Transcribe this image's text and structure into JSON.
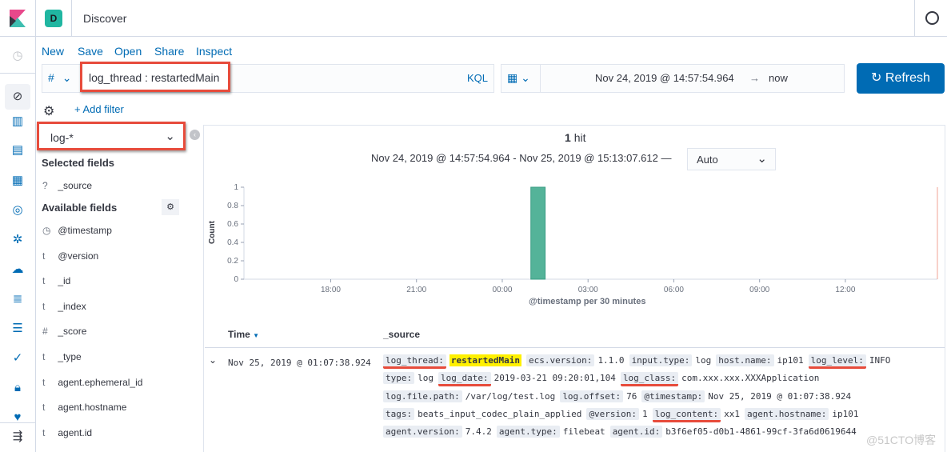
{
  "header": {
    "space_badge": "D",
    "title": "Discover",
    "logo": "kibana-logo",
    "help_icon": "help-icon"
  },
  "menu": {
    "new": "New",
    "save": "Save",
    "open": "Open",
    "share": "Share",
    "inspect": "Inspect"
  },
  "query": {
    "type_symbol": "#",
    "value": "log_thread : restartedMain",
    "language": "KQL"
  },
  "time": {
    "start": "Nov 24, 2019 @ 14:57:54.964",
    "arrow": "→",
    "end": "now",
    "refresh": "Refresh"
  },
  "filters": {
    "add_filter": "+ Add filter"
  },
  "index_pattern": "log-*",
  "sidebar": {
    "selected_title": "Selected fields",
    "selected": [
      {
        "type": "?",
        "name": "_source"
      }
    ],
    "available_title": "Available fields",
    "available": [
      {
        "type": "clock",
        "name": "@timestamp"
      },
      {
        "type": "t",
        "name": "@version"
      },
      {
        "type": "t",
        "name": "_id"
      },
      {
        "type": "t",
        "name": "_index"
      },
      {
        "type": "#",
        "name": "_score"
      },
      {
        "type": "t",
        "name": "_type"
      },
      {
        "type": "t",
        "name": "agent.ephemeral_id"
      },
      {
        "type": "t",
        "name": "agent.hostname"
      },
      {
        "type": "t",
        "name": "agent.id"
      }
    ]
  },
  "results": {
    "hits": "1",
    "hits_label": "hit",
    "range": "Nov 24, 2019 @ 14:57:54.964 - Nov 25, 2019 @ 15:13:07.612 —",
    "interval": "Auto"
  },
  "chart_data": {
    "type": "bar",
    "xlabel": "@timestamp per 30 minutes",
    "ylabel": "Count",
    "x_ticks": [
      "18:00",
      "21:00",
      "00:00",
      "03:00",
      "06:00",
      "09:00",
      "12:00"
    ],
    "y_ticks": [
      "0",
      "0.2",
      "0.4",
      "0.6",
      "0.8",
      "1"
    ],
    "ylim": [
      0,
      1
    ],
    "xlim": [
      "Nov 24, 2019 14:57:54.964",
      "Nov 25, 2019 15:13:07.612"
    ],
    "bars": [
      {
        "x": "Nov 25, 2019 01:00",
        "value": 1
      }
    ],
    "bar_color": "#54b399"
  },
  "table": {
    "col_time": "Time",
    "col_source": "_source",
    "row": {
      "time": "Nov 25, 2019 @ 01:07:38.924",
      "lines": [
        [
          [
            "log_thread:",
            "restartedMain",
            true,
            true
          ],
          [
            "ecs.version:",
            "1.1.0"
          ],
          [
            "input.type:",
            "log"
          ],
          [
            "host.name:",
            "ip101"
          ],
          [
            "log_level:",
            "INFO",
            true
          ]
        ],
        [
          [
            "type:",
            "log"
          ],
          [
            "log_date:",
            "2019-03-21 09:20:01,104",
            true
          ],
          [
            "log_class:",
            "com.xxx.xxx.XXXApplication",
            true
          ]
        ],
        [
          [
            "log.file.path:",
            "/var/log/test.log"
          ],
          [
            "log.offset:",
            "76"
          ],
          [
            "@timestamp:",
            "Nov 25, 2019 @ 01:07:38.924"
          ]
        ],
        [
          [
            "tags:",
            "beats_input_codec_plain_applied"
          ],
          [
            "@version:",
            "1"
          ],
          [
            "log_content:",
            "xx1",
            true
          ],
          [
            "agent.hostname:",
            "ip101"
          ]
        ],
        [
          [
            "agent.version:",
            "7.4.2"
          ],
          [
            "agent.type:",
            "filebeat"
          ],
          [
            "agent.id:",
            "b3f6ef05-d0b1-4861-99cf-3fa6d0619644"
          ]
        ]
      ]
    }
  },
  "watermark": "@51CTO博客"
}
